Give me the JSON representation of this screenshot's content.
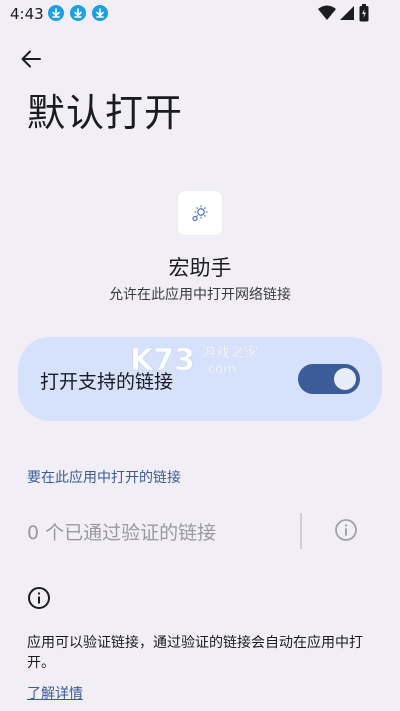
{
  "status_bar": {
    "time": "4:43",
    "notification_icons": [
      "download-icon",
      "download-icon",
      "download-icon"
    ],
    "system_icons": [
      "wifi-icon",
      "signal-icon",
      "battery-icon"
    ]
  },
  "header": {
    "back_icon": "arrow-left-icon",
    "title": "默认打开"
  },
  "app": {
    "icon": "gear-icon",
    "name": "宏助手",
    "description": "允许在此应用中打开网络链接"
  },
  "toggle": {
    "label": "打开支持的链接",
    "enabled": true
  },
  "watermark": {
    "brand": "K73",
    "subtitle": "游戏之家",
    "domain": ".com"
  },
  "links_section": {
    "header": "要在此应用中打开的链接",
    "verified_links": "0 个已通过验证的链接"
  },
  "info": {
    "icon": "info-icon",
    "text": "应用可以验证链接，通过验证的链接会自动在应用中打开。",
    "learn_more": "了解详情"
  },
  "colors": {
    "background": "#f1eff5",
    "accent": "#3b5b99",
    "card": "#d6e2fb",
    "status_download": "#1aa0e6"
  }
}
